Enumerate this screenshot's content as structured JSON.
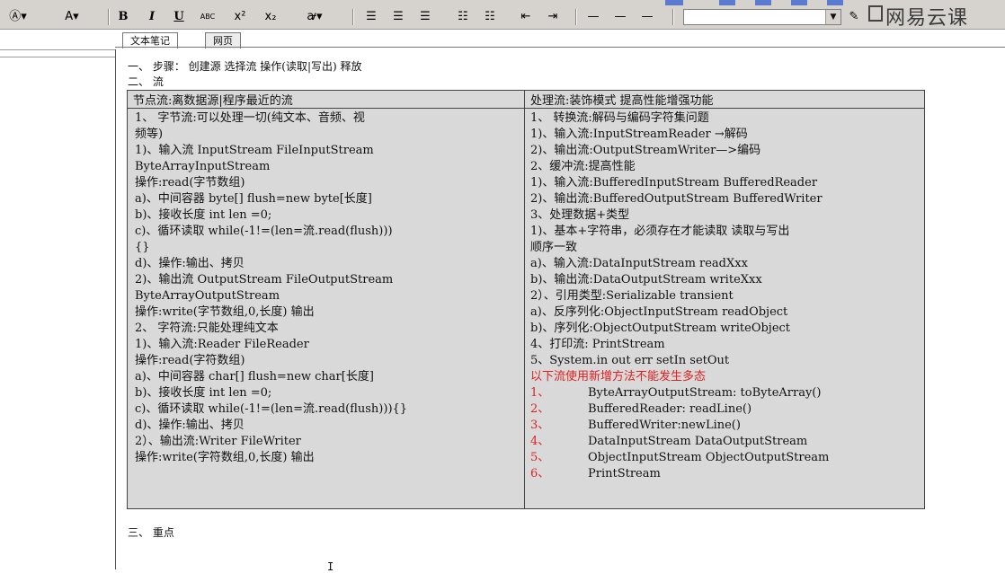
{
  "toolbar": {
    "items": [
      {
        "label": "Ⓐ▾",
        "name": "style-icon"
      },
      {
        "label": "A▾",
        "name": "font-color-icon"
      },
      {
        "label": "B",
        "name": "bold-button"
      },
      {
        "label": "I",
        "name": "italic-button"
      },
      {
        "label": "U",
        "name": "underline-button"
      },
      {
        "label": "ABC",
        "name": "strikethrough-button"
      },
      {
        "label": "x²",
        "name": "superscript-button"
      },
      {
        "label": "x₂",
        "name": "subscript-button"
      },
      {
        "label": "ꜻ▾",
        "name": "highlight-button"
      }
    ],
    "combo_value": "",
    "brand": "网易云课"
  },
  "tabs": [
    {
      "label": "文本笔记"
    },
    {
      "label": "网页"
    }
  ],
  "doc": {
    "line1": "一、 步骤： 创建源 选择流 操作(读取|写出) 释放",
    "line2": "二、 流",
    "line3": "三、 重点"
  },
  "table": {
    "left_header": "节点流:离数据源|程序最近的流",
    "right_header": "处理流:装饰模式 提高性能增强功能",
    "left_lines": [
      "1、        字节流:可以处理一切(纯文本、音频、视",
      "   频等)",
      "   1)、输入流 InputStream FileInputStream",
      "                ByteArrayInputStream",
      "   操作:read(字节数组)",
      "    a)、中间容器  byte[] flush=new byte[长度]",
      "    b)、接收长度  int len =0;",
      "     c)、循环读取 while(-1!=(len=流.read(flush)))",
      "   {}",
      "     d)、操作:输出、拷贝",
      "   2)、输出流 OutputStream FileOutputStream",
      "ByteArrayOutputStream",
      "   操作:write(字节数组,0,长度) 输出",
      "2、        字符流:只能处理纯文本",
      "   1)、输入流:Reader FileReader",
      "   操作:read(字符数组)",
      "   a)、中间容器  char[] flush=new char[长度]",
      "   b)、接收长度  int len =0;",
      "  c)、循环读取 while(-1!=(len=流.read(flush))){}",
      "   d)、操作:输出、拷贝",
      "   2）、输出流:Writer FileWriter",
      "   操作:write(字符数组,0,长度) 输出"
    ],
    "right_lines": [
      {
        "text": "1、        转换流:解码与编码字符集问题",
        "red": false
      },
      {
        "text": "     1)、输入流:InputStreamReader →解码",
        "red": false
      },
      {
        "text": "     2)、输出流:OutputStreamWriter—>编码",
        "red": false
      },
      {
        "text": "2、缓冲流:提高性能",
        "red": false
      },
      {
        "text": "  1)、输入流:BufferedInputStream BufferedReader",
        "red": false
      },
      {
        "text": "  2)、输出流:BufferedOutputStream BufferedWriter",
        "red": false
      },
      {
        "text": "3、处理数据+类型",
        "red": false
      },
      {
        "text": "1)、基本+字符串，必须存在才能读取 读取与写出",
        "red": false
      },
      {
        "text": "顺序一致",
        "red": false
      },
      {
        "text": "  a)、输入流:DataInputStream readXxx",
        "red": false
      },
      {
        "text": "  b)、输出流:DataOutputStream writeXxx",
        "red": false
      },
      {
        "text": "2）、引用类型:Serializable transient",
        "red": false
      },
      {
        "text": "  a)、反序列化:ObjectInputStream readObject",
        "red": false
      },
      {
        "text": "  b)、序列化:ObjectOutputStream writeObject",
        "red": false
      },
      {
        "text": "4、打印流: PrintStream",
        "red": false
      },
      {
        "text": "5、System.in out err  setIn setOut",
        "red": false
      },
      {
        "text": "以下流使用新增方法不能发生多态",
        "red": true
      }
    ],
    "numbered": [
      {
        "num": "1、",
        "text": "ByteArrayOutputStream:  toByteArray()"
      },
      {
        "num": "2、",
        "text": "BufferedReader: readLine()"
      },
      {
        "num": "3、",
        "text": "BufferedWriter:newLine()"
      },
      {
        "num": "4、",
        "text": "DataInputStream DataOutputStream"
      },
      {
        "num": "5、",
        "text": "ObjectInputStream ObjectOutputStream"
      },
      {
        "num": "6、",
        "text": "PrintStream"
      }
    ]
  },
  "colors": {
    "accent_red": "#e02020",
    "table_bg": "#d9d9d9",
    "toolbar_bg": "#d6d3ce"
  }
}
